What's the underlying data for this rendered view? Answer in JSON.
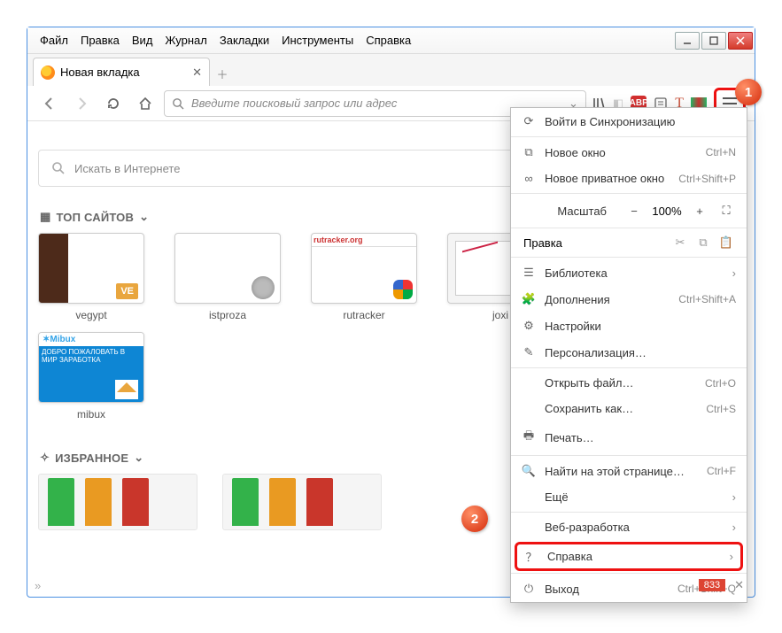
{
  "window": {
    "menubar": [
      "Файл",
      "Правка",
      "Вид",
      "Журнал",
      "Закладки",
      "Инструменты",
      "Справка"
    ]
  },
  "tab": {
    "title": "Новая вкладка"
  },
  "nav": {
    "url_placeholder": "Введите поисковый запрос или адрес"
  },
  "content": {
    "search_placeholder": "Искать в Интернете",
    "top_sites_label": "ТОП САЙТОВ",
    "fav_label": "ИЗБРАННОЕ",
    "tiles": [
      "vegypt",
      "istproza",
      "rutracker",
      "joxi",
      "mibux"
    ]
  },
  "icons": {
    "abp": "ABP"
  },
  "menu": {
    "sync": "Войти в Синхронизацию",
    "new_window": "Новое окно",
    "new_window_sc": "Ctrl+N",
    "private": "Новое приватное окно",
    "private_sc": "Ctrl+Shift+P",
    "zoom_label": "Масштаб",
    "zoom_value": "100%",
    "edit_label": "Правка",
    "library": "Библиотека",
    "addons": "Дополнения",
    "addons_sc": "Ctrl+Shift+A",
    "settings": "Настройки",
    "customize": "Персонализация…",
    "open_file": "Открыть файл…",
    "open_file_sc": "Ctrl+O",
    "save_as": "Сохранить как…",
    "save_as_sc": "Ctrl+S",
    "print": "Печать…",
    "find": "Найти на этой странице…",
    "find_sc": "Ctrl+F",
    "more": "Ещё",
    "webdev": "Веб-разработка",
    "help": "Справка",
    "quit": "Выход",
    "quit_sc": "Ctrl+Shift+Q"
  },
  "callouts": {
    "one": "1",
    "two": "2"
  },
  "footer": {
    "badge": "833"
  }
}
